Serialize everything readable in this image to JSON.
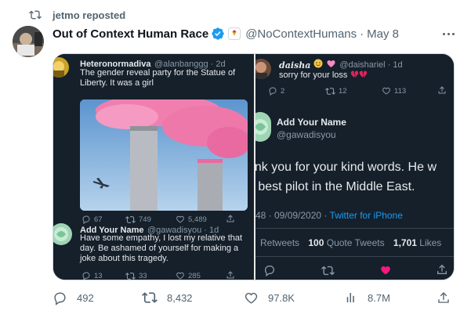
{
  "repost": {
    "label": "jetmo reposted"
  },
  "tweet": {
    "author_name": "Out of Context Human Race",
    "handle": "@NoContextHumans",
    "separator": "·",
    "date": "May 8",
    "actions": {
      "replies": "492",
      "reposts": "8,432",
      "likes": "97.8K",
      "views": "8.7M"
    }
  },
  "left_panel": {
    "first": {
      "name": "Heteronormadiva",
      "handle": "@alanbanggg · 2d",
      "text_line1": "The gender reveal party for the Statue of",
      "text_line2": "Liberty. It was a girl",
      "replies": "67",
      "retweets": "749",
      "likes": "5,489"
    },
    "second": {
      "name": "Add Your Name",
      "handle": "@gawadisyou · 1d",
      "text_line1": "Have some empathy, I lost my relative that",
      "text_line2": "day.  Be ashamed of yourself for making a",
      "text_line3": "joke about this tragedy.",
      "replies": "13",
      "retweets": "33",
      "likes": "285"
    }
  },
  "right_panel": {
    "top": {
      "name": "daisha",
      "handle": "@daishariel · 1d",
      "text": "sorry for your loss",
      "replies": "2",
      "retweets": "12",
      "likes": "113"
    },
    "main": {
      "name": "Add Your Name",
      "handle": "@gawadisyou",
      "text_line1": "ank you for your kind words. He w",
      "text_line2": "e best pilot in the Middle East.",
      "meta": "48 · 09/09/2020 · ",
      "source": "Twitter for iPhone",
      "retweets_label": "Retweets",
      "quotes_count": "100",
      "quotes_label": "Quote Tweets",
      "likes_count": "1,701",
      "likes_label": "Likes"
    }
  },
  "colors": {
    "accent": "#1d9bf0",
    "dark_bg": "#15202b",
    "muted": "#536471",
    "like_red": "#f91880"
  }
}
